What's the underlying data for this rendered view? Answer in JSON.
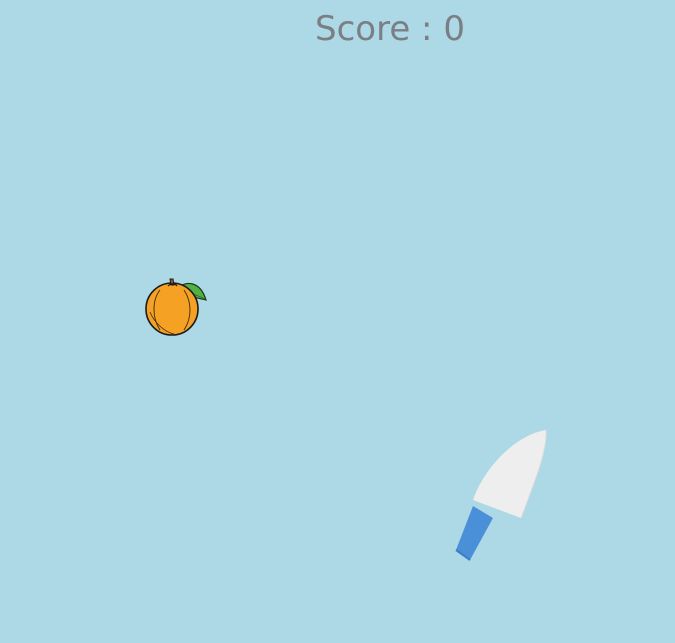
{
  "game": {
    "score_prefix": "Score",
    "score_separator": " : ",
    "score_value": 0
  },
  "objects": {
    "fruit": "orange",
    "blade": "knife"
  },
  "colors": {
    "background": "#add8e6",
    "score_text": "#7a7f84",
    "orange": "#f5a123",
    "leaf": "#52b047",
    "knife_blade": "#eeeeee",
    "knife_handle": "#4a90d9"
  }
}
